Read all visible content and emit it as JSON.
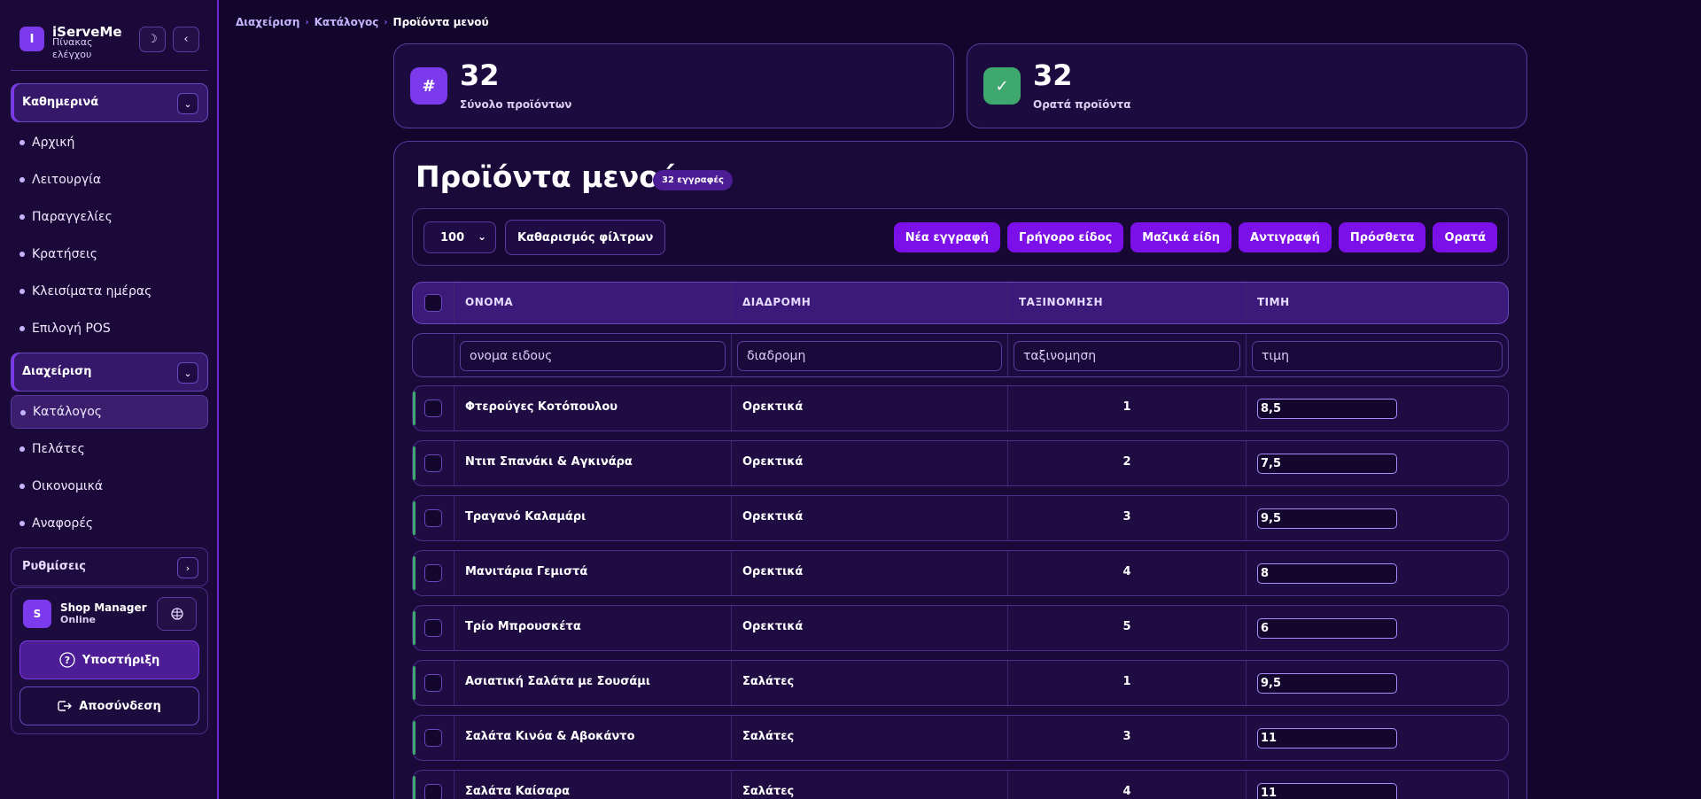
{
  "brand": {
    "logo_letter": "I",
    "name": "iServeMe",
    "subtitle": "Πίνακας ελέγχου",
    "theme_icon": "moon-icon",
    "collapse_icon": "chevron-left-icon"
  },
  "sidebar": {
    "daily_section": {
      "label": "Καθημερινά",
      "items": [
        "Αρχική",
        "Λειτουργία",
        "Παραγγελίες",
        "Κρατήσεις",
        "Κλεισίματα ημέρας",
        "Επιλογή POS"
      ]
    },
    "admin_section": {
      "label": "Διαχείριση",
      "items": [
        "Κατάλογος",
        "Πελάτες",
        "Οικονομικά",
        "Αναφορές"
      ],
      "active": "Κατάλογος"
    },
    "settings_section": {
      "label": "Ρυθμίσεις"
    }
  },
  "user": {
    "initial": "S",
    "name": "Shop Manager",
    "status": "Online",
    "support_label": "Υποστήριξη",
    "logout_label": "Αποσύνδεση"
  },
  "breadcrumb": [
    "Διαχείριση",
    "Κατάλογος",
    "Προϊόντα μενού"
  ],
  "stats": [
    {
      "icon_glyph": "#",
      "value": "32",
      "label": "Σύνολο προϊόντων",
      "color": "#7c3aed"
    },
    {
      "icon_glyph": "✓",
      "value": "32",
      "label": "Ορατά προϊόντα",
      "color": "#3fa86f"
    }
  ],
  "panel": {
    "title": "Προϊόντα μενού",
    "badge": "32 εγγραφές",
    "page_size": "100",
    "clear_filters": "Καθαρισμός φίλτρων",
    "actions": [
      "Νέα εγγραφή",
      "Γρήγορο είδος",
      "Μαζικά είδη",
      "Αντιγραφή",
      "Πρόσθετα",
      "Ορατά"
    ]
  },
  "table": {
    "columns": [
      "ΟΝΟΜΑ",
      "ΔΙΑΔΡΟΜΗ",
      "ΤΑΞΙΝΟΜΗΣΗ",
      "ΤΙΜΗ"
    ],
    "filter_placeholders": [
      "ονομα ειδους",
      "διαδρομη",
      "ταξινομηση",
      "τιμη"
    ],
    "rows": [
      {
        "name": "Φτερούγες Κοτόπουλου",
        "route": "Ορεκτικά",
        "sort": "1",
        "price": "8,5"
      },
      {
        "name": "Ντιπ Σπανάκι & Αγκινάρα",
        "route": "Ορεκτικά",
        "sort": "2",
        "price": "7,5"
      },
      {
        "name": "Τραγανό Καλαμάρι",
        "route": "Ορεκτικά",
        "sort": "3",
        "price": "9,5"
      },
      {
        "name": "Μανιτάρια Γεμιστά",
        "route": "Ορεκτικά",
        "sort": "4",
        "price": "8"
      },
      {
        "name": "Τρίο Μπρουσκέτα",
        "route": "Ορεκτικά",
        "sort": "5",
        "price": "6"
      },
      {
        "name": "Ασιατική Σαλάτα με Σουσάμι",
        "route": "Σαλάτες",
        "sort": "1",
        "price": "9,5"
      },
      {
        "name": "Σαλάτα Κινόα & Αβοκάντο",
        "route": "Σαλάτες",
        "sort": "3",
        "price": "11"
      },
      {
        "name": "Σαλάτα Καίσαρα",
        "route": "Σαλάτες",
        "sort": "4",
        "price": "11"
      }
    ]
  },
  "colors": {
    "accent": "#7c10e8",
    "background": "#12062c",
    "visible_marker": "#3fa86f"
  }
}
